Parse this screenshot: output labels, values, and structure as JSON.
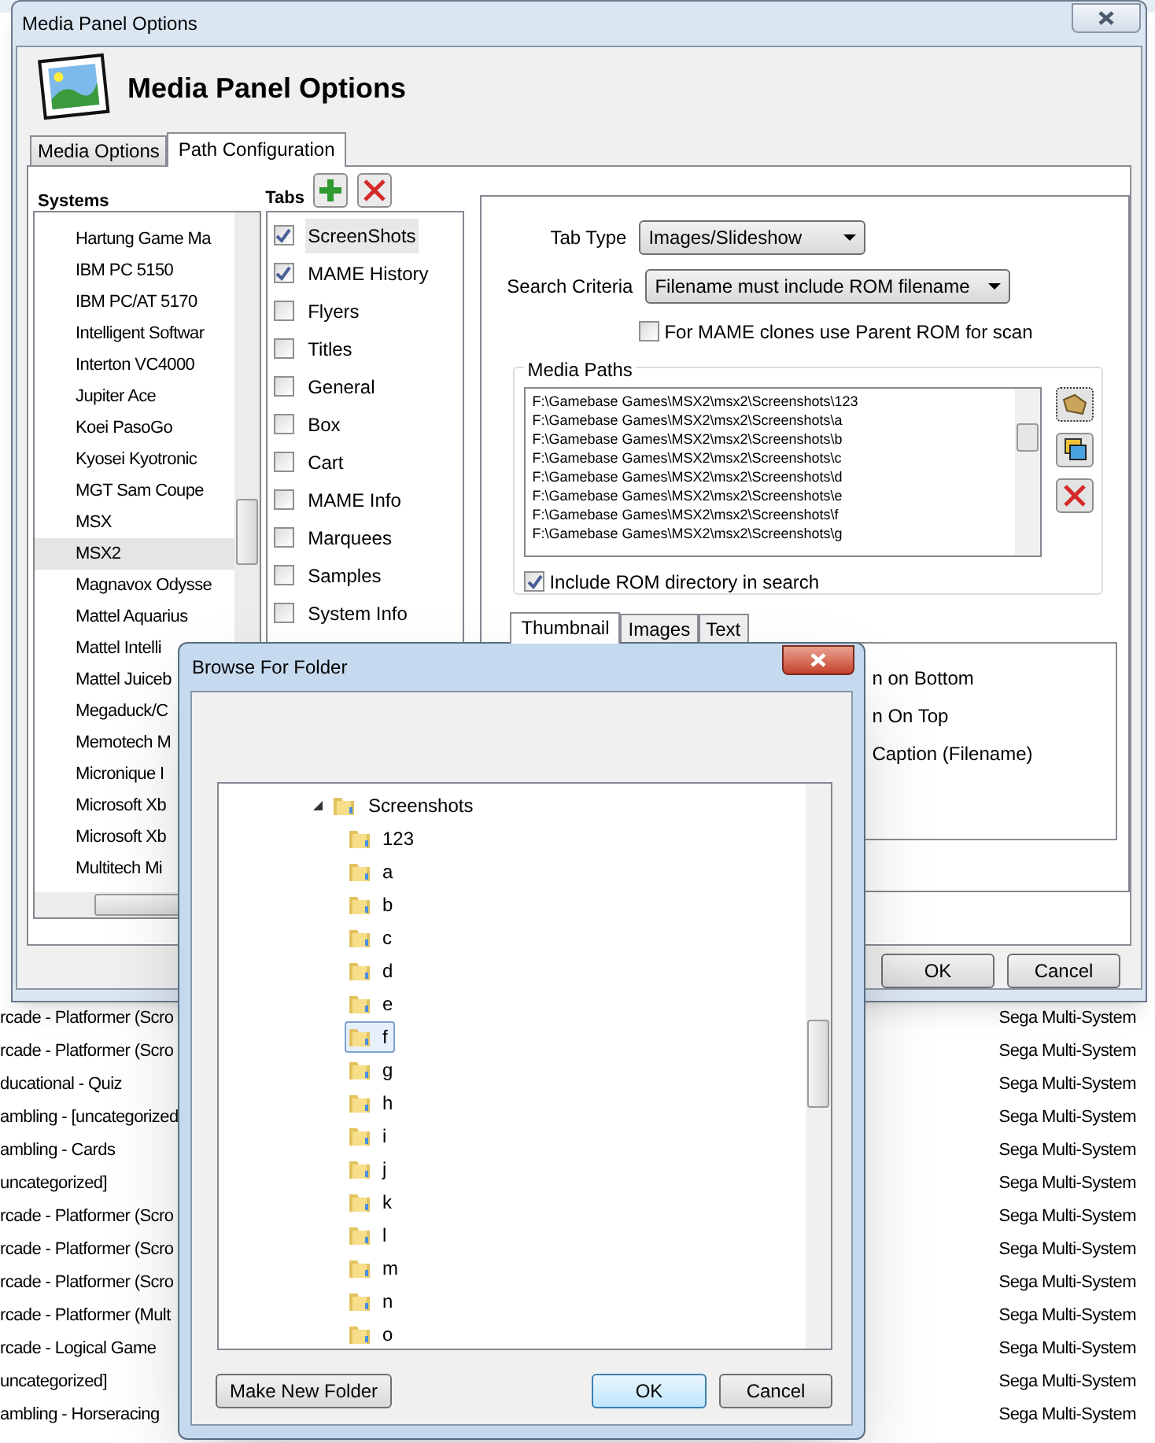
{
  "background_rows": [
    {
      "column_1": "rcade - Platformer (Scro",
      "column_2": "Sega Multi-System"
    },
    {
      "column_1": "rcade - Platformer (Scro",
      "column_2": "Sega Multi-System"
    },
    {
      "column_1": "ducational - Quiz",
      "column_2": "Sega Multi-System"
    },
    {
      "column_1": "ambling - [uncategorized",
      "column_2": "Sega Multi-System"
    },
    {
      "column_1": "ambling - Cards",
      "column_2": "Sega Multi-System"
    },
    {
      "column_1": "uncategorized]",
      "column_2": "Sega Multi-System"
    },
    {
      "column_1": "rcade - Platformer (Scro",
      "column_2": "Sega Multi-System"
    },
    {
      "column_1": "rcade - Platformer (Scro",
      "column_2": "Sega Multi-System"
    },
    {
      "column_1": "rcade - Platformer (Scro",
      "column_2": "Sega Multi-System"
    },
    {
      "column_1": "rcade - Platformer (Mult",
      "column_2": "Sega Multi-System"
    },
    {
      "column_1": "rcade - Logical Game",
      "column_2": "Sega Multi-System"
    },
    {
      "column_1": "uncategorized]",
      "column_2": "Sega Multi-System"
    },
    {
      "column_1": "ambling - Horseracing",
      "column_2": "Sega Multi-System"
    }
  ],
  "main_window": {
    "title": "Media Panel Options",
    "header_title": "Media Panel Options",
    "tabs": [
      {
        "label": "Media Options",
        "selected": false
      },
      {
        "label": "Path Configuration",
        "selected": true
      }
    ],
    "systems": {
      "label": "Systems",
      "items": [
        {
          "label": "Hartung Game Ma",
          "selected": false
        },
        {
          "label": "IBM PC 5150",
          "selected": false
        },
        {
          "label": "IBM PC/AT 5170",
          "selected": false
        },
        {
          "label": "Intelligent Softwar",
          "selected": false
        },
        {
          "label": "Interton VC4000",
          "selected": false
        },
        {
          "label": "Jupiter Ace",
          "selected": false
        },
        {
          "label": "Koei PasoGo",
          "selected": false
        },
        {
          "label": "Kyosei Kyotronic",
          "selected": false
        },
        {
          "label": "MGT Sam Coupe",
          "selected": false
        },
        {
          "label": "MSX",
          "selected": false
        },
        {
          "label": "MSX2",
          "selected": true
        },
        {
          "label": "Magnavox Odysse",
          "selected": false
        },
        {
          "label": "Mattel Aquarius",
          "selected": false
        },
        {
          "label": "Mattel Intelli",
          "selected": false
        },
        {
          "label": "Mattel Juiceb",
          "selected": false
        },
        {
          "label": "Megaduck/C",
          "selected": false
        },
        {
          "label": "Memotech M",
          "selected": false
        },
        {
          "label": "Micronique I",
          "selected": false
        },
        {
          "label": "Microsoft Xb",
          "selected": false
        },
        {
          "label": "Microsoft Xb",
          "selected": false
        },
        {
          "label": "Multitech Mi",
          "selected": false
        }
      ]
    },
    "media_tabs": {
      "label": "Tabs",
      "items": [
        {
          "label": "ScreenShots",
          "checked": true,
          "selected": true
        },
        {
          "label": "MAME History",
          "checked": true,
          "selected": false
        },
        {
          "label": "Flyers",
          "checked": false,
          "selected": false
        },
        {
          "label": "Titles",
          "checked": false,
          "selected": false
        },
        {
          "label": "General",
          "checked": false,
          "selected": false
        },
        {
          "label": "Box",
          "checked": false,
          "selected": false
        },
        {
          "label": "Cart",
          "checked": false,
          "selected": false
        },
        {
          "label": "MAME Info",
          "checked": false,
          "selected": false
        },
        {
          "label": "Marquees",
          "checked": false,
          "selected": false
        },
        {
          "label": "Samples",
          "checked": false,
          "selected": false
        },
        {
          "label": "System Info",
          "checked": false,
          "selected": false
        }
      ]
    },
    "tab_type": {
      "label": "Tab Type",
      "value": "Images/Slideshow"
    },
    "search_criteria": {
      "label": "Search Criteria",
      "value": "Filename must include ROM filename"
    },
    "parent_rom": {
      "label": "For MAME clones use Parent ROM for scan",
      "checked": false
    },
    "media_paths": {
      "label": "Media Paths",
      "paths": [
        "F:\\Gamebase Games\\MSX2\\msx2\\Screenshots\\123",
        "F:\\Gamebase Games\\MSX2\\msx2\\Screenshots\\a",
        "F:\\Gamebase Games\\MSX2\\msx2\\Screenshots\\b",
        "F:\\Gamebase Games\\MSX2\\msx2\\Screenshots\\c",
        "F:\\Gamebase Games\\MSX2\\msx2\\Screenshots\\d",
        "F:\\Gamebase Games\\MSX2\\msx2\\Screenshots\\e",
        "F:\\Gamebase Games\\MSX2\\msx2\\Screenshots\\f",
        "F:\\Gamebase Games\\MSX2\\msx2\\Screenshots\\g"
      ],
      "include_rom": {
        "label": "Include ROM directory in search",
        "checked": true
      }
    },
    "sub_tabs": [
      {
        "label": "Thumbnail",
        "selected": true
      },
      {
        "label": "Images",
        "selected": false
      },
      {
        "label": "Text",
        "selected": false
      }
    ],
    "caption_options": [
      "n on Bottom",
      "n On Top",
      "Caption (Filename)"
    ],
    "buttons": [
      "OK",
      "Cancel"
    ]
  },
  "browse_dialog": {
    "title": "Browse For Folder",
    "tree": {
      "label": "Screenshots",
      "expanded": true,
      "children": [
        {
          "label": "123",
          "selected": false
        },
        {
          "label": "a",
          "selected": false
        },
        {
          "label": "b",
          "selected": false
        },
        {
          "label": "c",
          "selected": false
        },
        {
          "label": "d",
          "selected": false
        },
        {
          "label": "e",
          "selected": false
        },
        {
          "label": "f",
          "selected": true
        },
        {
          "label": "g",
          "selected": false
        },
        {
          "label": "h",
          "selected": false
        },
        {
          "label": "i",
          "selected": false
        },
        {
          "label": "j",
          "selected": false
        },
        {
          "label": "k",
          "selected": false
        },
        {
          "label": "l",
          "selected": false
        },
        {
          "label": "m",
          "selected": false
        },
        {
          "label": "n",
          "selected": false
        },
        {
          "label": "o",
          "selected": false
        }
      ]
    },
    "make_new_folder": "Make New Folder",
    "ok": "OK",
    "cancel": "Cancel"
  }
}
